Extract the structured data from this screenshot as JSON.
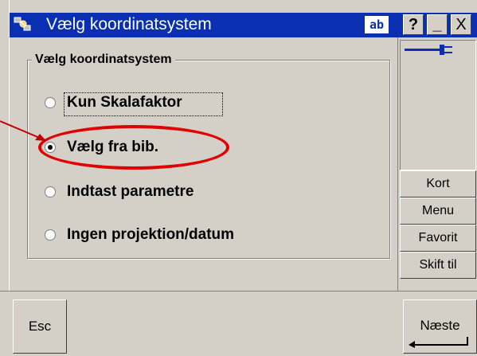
{
  "window": {
    "title": "Vælg koordinatsystem",
    "title_icon": "satellite-icon",
    "ab_label": "ab",
    "help_label": "?",
    "minimize_label": "_",
    "close_label": "X"
  },
  "group": {
    "title": "Vælg koordinatsystem",
    "options": [
      {
        "label": "Kun Skalafaktor",
        "selected": false
      },
      {
        "label": "Vælg fra bib.",
        "selected": true
      },
      {
        "label": "Indtast parametre",
        "selected": false
      },
      {
        "label": "Ingen projektion/datum",
        "selected": false
      }
    ]
  },
  "side_buttons": [
    "Kort",
    "Menu",
    "Favorit",
    "Skift til"
  ],
  "bottom": {
    "esc_label": "Esc",
    "next_label": "Næste"
  },
  "colors": {
    "titlebar": "#0a2fb0",
    "annotation": "#e00000",
    "plug": "#0a2fb0"
  }
}
